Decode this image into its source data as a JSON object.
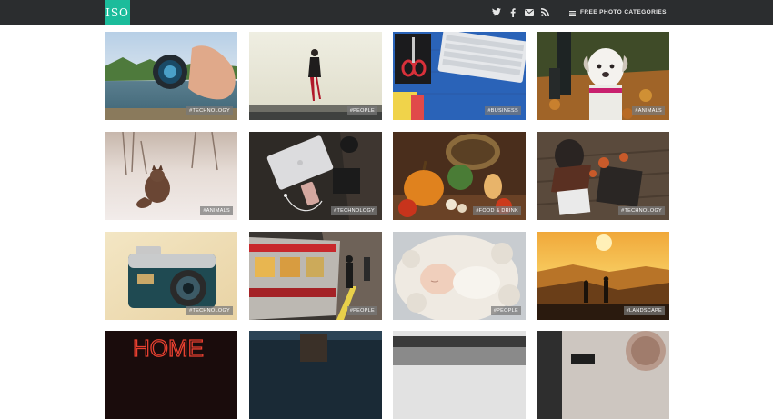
{
  "header": {
    "logo_text": "ISO",
    "menu_label": "FREE PHOTO CATEGORIES",
    "social_icons": [
      "twitter-icon",
      "facebook-icon",
      "email-icon",
      "rss-icon"
    ]
  },
  "colors": {
    "topbar": "#2b2d2f",
    "logo_bg": "#1bbc9b",
    "background": "#ffffff"
  },
  "photos": [
    {
      "subject": "hand-holding-lens",
      "tag": "#TECHNOLOGY"
    },
    {
      "subject": "woman-on-ledge",
      "tag": "#PEOPLE"
    },
    {
      "subject": "desk-keyboard-scissors",
      "tag": "#BUSINESS"
    },
    {
      "subject": "white-puppy",
      "tag": "#ANIMALS"
    },
    {
      "subject": "fox-in-snow",
      "tag": "#ANIMALS"
    },
    {
      "subject": "laptop-phone-desk",
      "tag": "#TECHNOLOGY"
    },
    {
      "subject": "pumpkins-basket",
      "tag": "#FOOD & DRINK"
    },
    {
      "subject": "woman-with-laptop-autumn",
      "tag": "#TECHNOLOGY"
    },
    {
      "subject": "vintage-camera",
      "tag": "#TECHNOLOGY"
    },
    {
      "subject": "subway-train",
      "tag": "#PEOPLE"
    },
    {
      "subject": "sleeping-baby",
      "tag": "#PEOPLE"
    },
    {
      "subject": "hikers-at-sunset",
      "tag": "#LANDSCAPE"
    },
    {
      "subject": "home-neon-sign",
      "tag": ""
    },
    {
      "subject": "dark-scene",
      "tag": ""
    },
    {
      "subject": "blurred-window",
      "tag": ""
    },
    {
      "subject": "coffee-table",
      "tag": ""
    }
  ],
  "overlay_text": {
    "neon_sign": "HOME"
  }
}
